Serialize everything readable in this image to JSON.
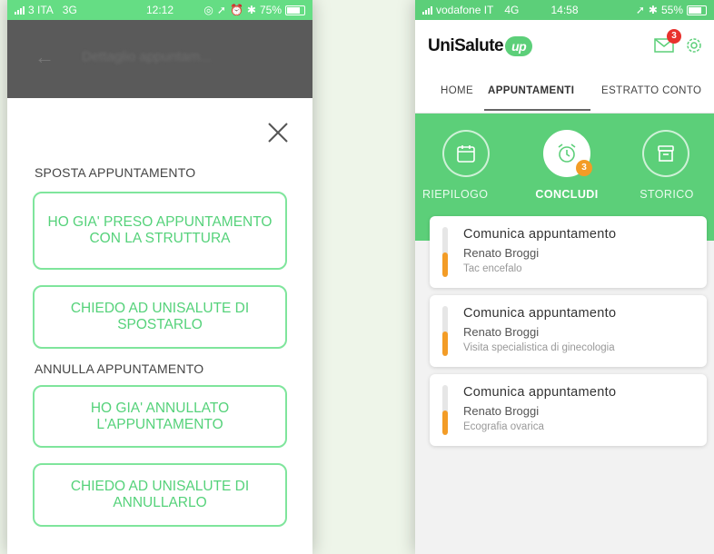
{
  "left": {
    "status": {
      "carrier": "3 ITA",
      "network": "3G",
      "time": "12:12",
      "battery": "75%"
    },
    "header_title": "Dettaglio appuntam...",
    "sections": [
      {
        "title": "SPOSTA APPUNTAMENTO"
      },
      {
        "title": "ANNULLA APPUNTAMENTO"
      }
    ],
    "buttons": [
      "HO GIA' PRESO APPUNTAMENTO CON LA STRUTTURA",
      "CHIEDO AD UNISALUTE DI SPOSTARLO",
      "HO GIA' ANNULLATO L'APPUNTAMENTO",
      "CHIEDO AD UNISALUTE DI ANNULLARLO"
    ]
  },
  "right": {
    "status": {
      "carrier": "vodafone IT",
      "network": "4G",
      "time": "14:58",
      "battery": "55%"
    },
    "logo_text": "UniSalute",
    "logo_badge": "up",
    "mail_badge": "3",
    "tabs": [
      "HOME",
      "APPUNTAMENTI",
      "ESTRATTO CONTO"
    ],
    "active_tab": "APPUNTAMENTI",
    "sections": [
      {
        "label": "RIEPILOGO",
        "icon": "calendar-icon"
      },
      {
        "label": "CONCLUDI",
        "icon": "alarm-clock-icon",
        "badge": "3"
      },
      {
        "label": "STORICO",
        "icon": "archive-box-icon"
      }
    ],
    "cards": [
      {
        "title": "Comunica appuntamento",
        "name": "Renato Broggi",
        "desc": "Tac encefalo",
        "progress": 0.5
      },
      {
        "title": "Comunica appuntamento",
        "name": "Renato Broggi",
        "desc": "Visita specialistica di ginecologia",
        "progress": 0.5
      },
      {
        "title": "Comunica appuntamento",
        "name": "Renato Broggi",
        "desc": "Ecografia ovarica",
        "progress": 0.5
      }
    ]
  },
  "colors": {
    "accent_green": "#5ccf79",
    "button_border": "#7fe59c",
    "badge_orange": "#f39c26",
    "badge_red": "#e8312d"
  }
}
